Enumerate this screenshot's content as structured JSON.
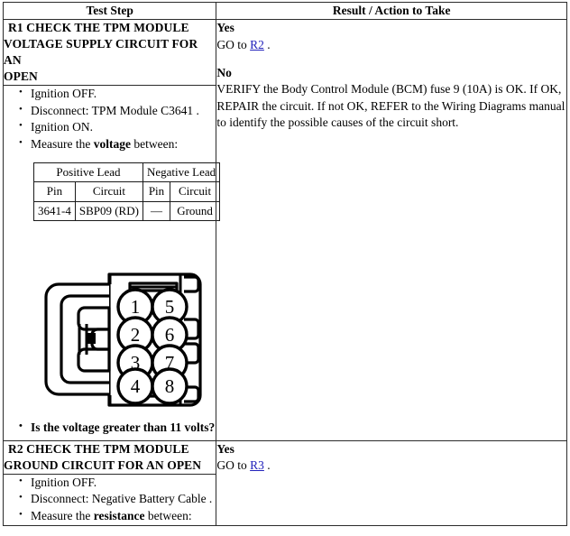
{
  "table": {
    "headers": {
      "step": "Test Step",
      "result": "Result / Action to Take"
    }
  },
  "steps": [
    {
      "id": "R1",
      "heading": "R1 CHECK THE TPM MODULE VOLTAGE SUPPLY CIRCUIT FOR AN OPEN",
      "heading_lines": [
        "R1 CHECK THE TPM MODULE",
        "VOLTAGE SUPPLY CIRCUIT FOR AN",
        "OPEN"
      ],
      "bullets": [
        "Ignition OFF.",
        "Disconnect: TPM Module C3641 .",
        "Ignition ON.",
        "Measure the voltage between:"
      ],
      "bullet_rich": [
        {
          "pre": "Ignition OFF.",
          "bold": "",
          "post": ""
        },
        {
          "pre": "Disconnect: TPM Module C3641 .",
          "bold": "",
          "post": ""
        },
        {
          "pre": "Ignition ON.",
          "bold": "",
          "post": ""
        },
        {
          "pre": "Measure the ",
          "bold": "voltage",
          "post": " between:"
        }
      ],
      "lead_table": {
        "group_headers": [
          "Positive Lead",
          "Negative Lead"
        ],
        "column_headers": [
          "Pin",
          "Circuit",
          "Pin",
          "Circuit"
        ],
        "rows": [
          [
            "3641-4",
            "SBP09 (RD)",
            "—",
            "Ground"
          ]
        ]
      },
      "connector": {
        "name": "8-way-connector-pin-view",
        "pin_labels": [
          "1",
          "2",
          "3",
          "4",
          "5",
          "6",
          "7",
          "8"
        ]
      },
      "question": "Is the voltage greater than 11 volts?",
      "result": {
        "yes_label": "Yes",
        "yes_text_pre": "GO to ",
        "yes_link": "R2",
        "yes_text_post": " .",
        "no_label": "No",
        "no_text": "VERIFY the Body Control Module (BCM) fuse 9 (10A) is OK. If OK, REPAIR the circuit. If not OK, REFER to the Wiring Diagrams manual to identify the possible causes of the circuit short."
      }
    },
    {
      "id": "R2",
      "heading": "R2 CHECK THE TPM MODULE GROUND CIRCUIT FOR AN OPEN",
      "heading_lines": [
        "R2 CHECK THE TPM MODULE",
        "GROUND CIRCUIT FOR AN OPEN"
      ],
      "bullets": [
        "Ignition OFF.",
        "Disconnect: Negative Battery Cable .",
        "Measure the resistance between:"
      ],
      "bullet_rich": [
        {
          "pre": "Ignition OFF.",
          "bold": "",
          "post": ""
        },
        {
          "pre": "Disconnect: Negative Battery Cable .",
          "bold": "",
          "post": ""
        },
        {
          "pre": "Measure the ",
          "bold": "resistance",
          "post": " between:"
        }
      ],
      "result": {
        "yes_label": "Yes",
        "yes_text_pre": "GO to ",
        "yes_link": "R3",
        "yes_text_post": " ."
      }
    }
  ],
  "colors": {
    "link": "#2222bb",
    "border": "#2b2b2b",
    "text": "#000000",
    "background": "#ffffff"
  }
}
